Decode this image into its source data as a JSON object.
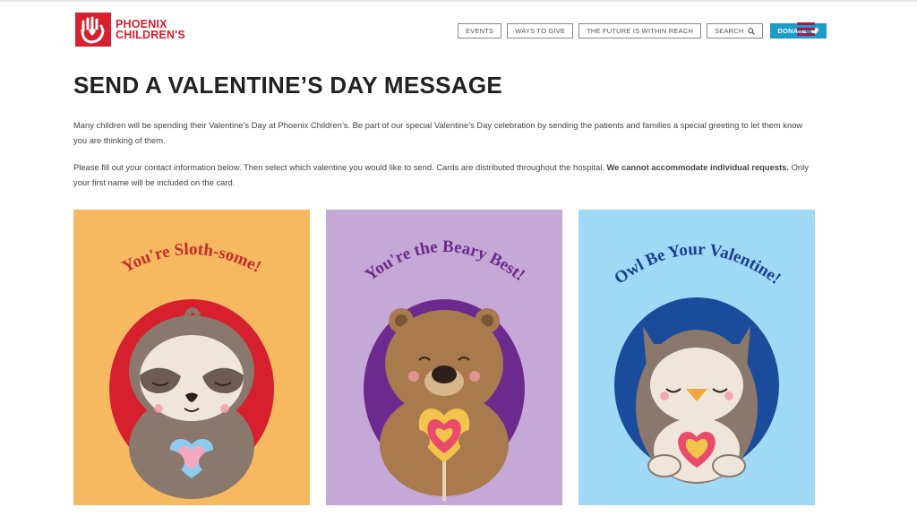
{
  "header": {
    "logo_line1": "PHOENIX",
    "logo_line2": "CHILDREN'S",
    "nav": {
      "events": "EVENTS",
      "ways_to_give": "WAYS TO GIVE",
      "future": "THE FUTURE IS WITHIN REACH",
      "search": "SEARCH",
      "donate": "DONATE"
    }
  },
  "page": {
    "title": "SEND A VALENTINE’S DAY MESSAGE",
    "para1": "Many children will be spending their Valentine’s Day at Phoenix Children’s. Be part of our special Valentine’s Day celebration by sending the patients and families a special greeting to let them know you are thinking of them.",
    "para2_part1": "Please fill out your contact information below. Then select which valentine you would like to send. Cards are distributed throughout the hospital. ",
    "para2_bold": "We cannot accommodate individual requests.",
    "para2_part2": " Only your first name will be included on the card."
  },
  "cards": [
    {
      "caption": "You're Sloth-some!",
      "animal": "sloth"
    },
    {
      "caption": "You're the Beary Best!",
      "animal": "bear"
    },
    {
      "caption": "Owl Be Your Valentine!",
      "animal": "owl"
    }
  ],
  "colors": {
    "brand_red": "#d6202e",
    "menu_magenta": "#b0124a",
    "donate_blue": "#1d9cc8",
    "card1_bg": "#f6b962",
    "card2_bg": "#c5a8d6",
    "card3_bg": "#9fd9f6"
  }
}
